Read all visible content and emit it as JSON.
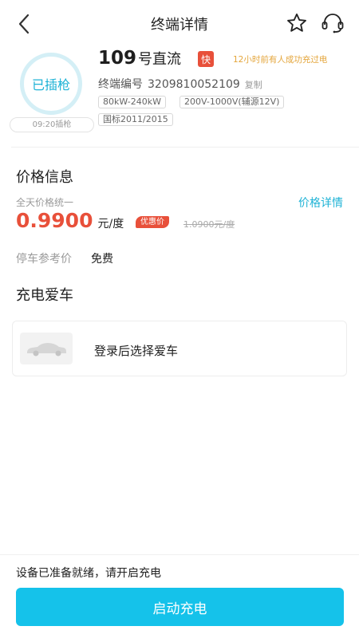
{
  "header": {
    "title": "终端详情",
    "back_icon": "chevron-left-icon",
    "favorite_icon": "star-outline-icon",
    "service_icon": "headset-icon"
  },
  "terminal": {
    "status": "已插枪",
    "plug_time": "09:20插枪",
    "number": "109",
    "type": "号直流",
    "fast_badge": "快",
    "success_tip": "12小时前有人成功充过电",
    "code_label": "终端编号",
    "code_value": "3209810052109",
    "copy_label": "复制",
    "tags": [
      "80kW-240kW",
      "200V-1000V(辅源12V)",
      "国标2011/2015"
    ]
  },
  "price": {
    "section_title": "价格信息",
    "unified_label": "全天价格统一",
    "detail_link": "价格详情",
    "current_price": "0.9900",
    "unit": "元/度",
    "discount_badge": "优惠价",
    "original_price": "1.0900元/度",
    "parking_label": "停车参考价",
    "parking_value": "免费"
  },
  "car": {
    "section_title": "充电爱车",
    "select_label": "登录后选择爱车",
    "car_icon": "car-icon"
  },
  "bottom": {
    "ready_text": "设备已准备就绪，请开启充电",
    "start_button": "启动充电"
  },
  "colors": {
    "accent": "#15c2ea",
    "price_red": "#e8503a",
    "tip_orange": "#e4a63c",
    "status_cyan": "#1fb3d6"
  }
}
